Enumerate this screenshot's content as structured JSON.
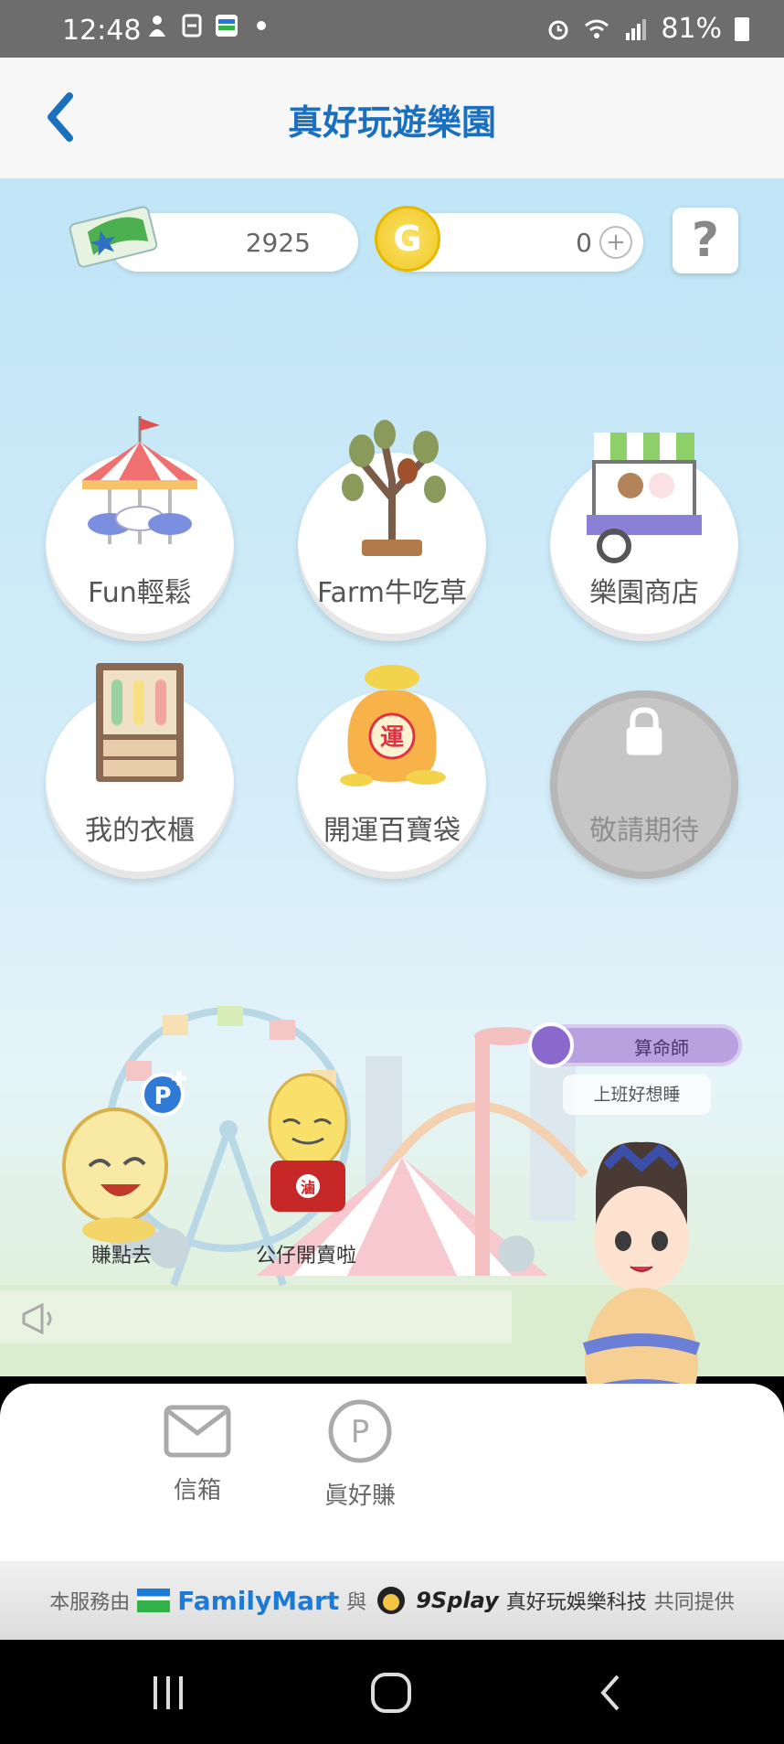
{
  "status_bar": {
    "time": "12:48",
    "battery": "81%"
  },
  "header": {
    "title": "真好玩遊樂園"
  },
  "currency": {
    "tickets": "2925",
    "coins": "0",
    "coin_symbol": "G",
    "plus": "+",
    "help": "?"
  },
  "menu": {
    "items": [
      {
        "label": "Fun輕鬆"
      },
      {
        "label": "Farm牛吃草"
      },
      {
        "label": "樂園商店"
      },
      {
        "label": "我的衣櫃"
      },
      {
        "label": "開運百寶袋"
      },
      {
        "label": "敬請期待"
      }
    ],
    "bag_char": "運"
  },
  "scene": {
    "npc_earn": "賺點去",
    "npc_sell": "公仔開賣啦",
    "fortune_tag": "算命師",
    "speech": "上班好想睡",
    "pot_char": "滷",
    "p_badge": "P"
  },
  "bottom_nav": {
    "mailbox": "信箱",
    "earn": "眞好賺",
    "earn_icon": "P"
  },
  "footer": {
    "prefix": "本服務由",
    "familymart": "FamilyMart",
    "and": "與",
    "play_brand": "9Splay",
    "company": "真好玩娛樂科技",
    "suffix": "共同提供"
  },
  "colors": {
    "accent": "#1a6fbf",
    "sky": "#bfe5f7",
    "status_bar": "#6d6d6d"
  }
}
